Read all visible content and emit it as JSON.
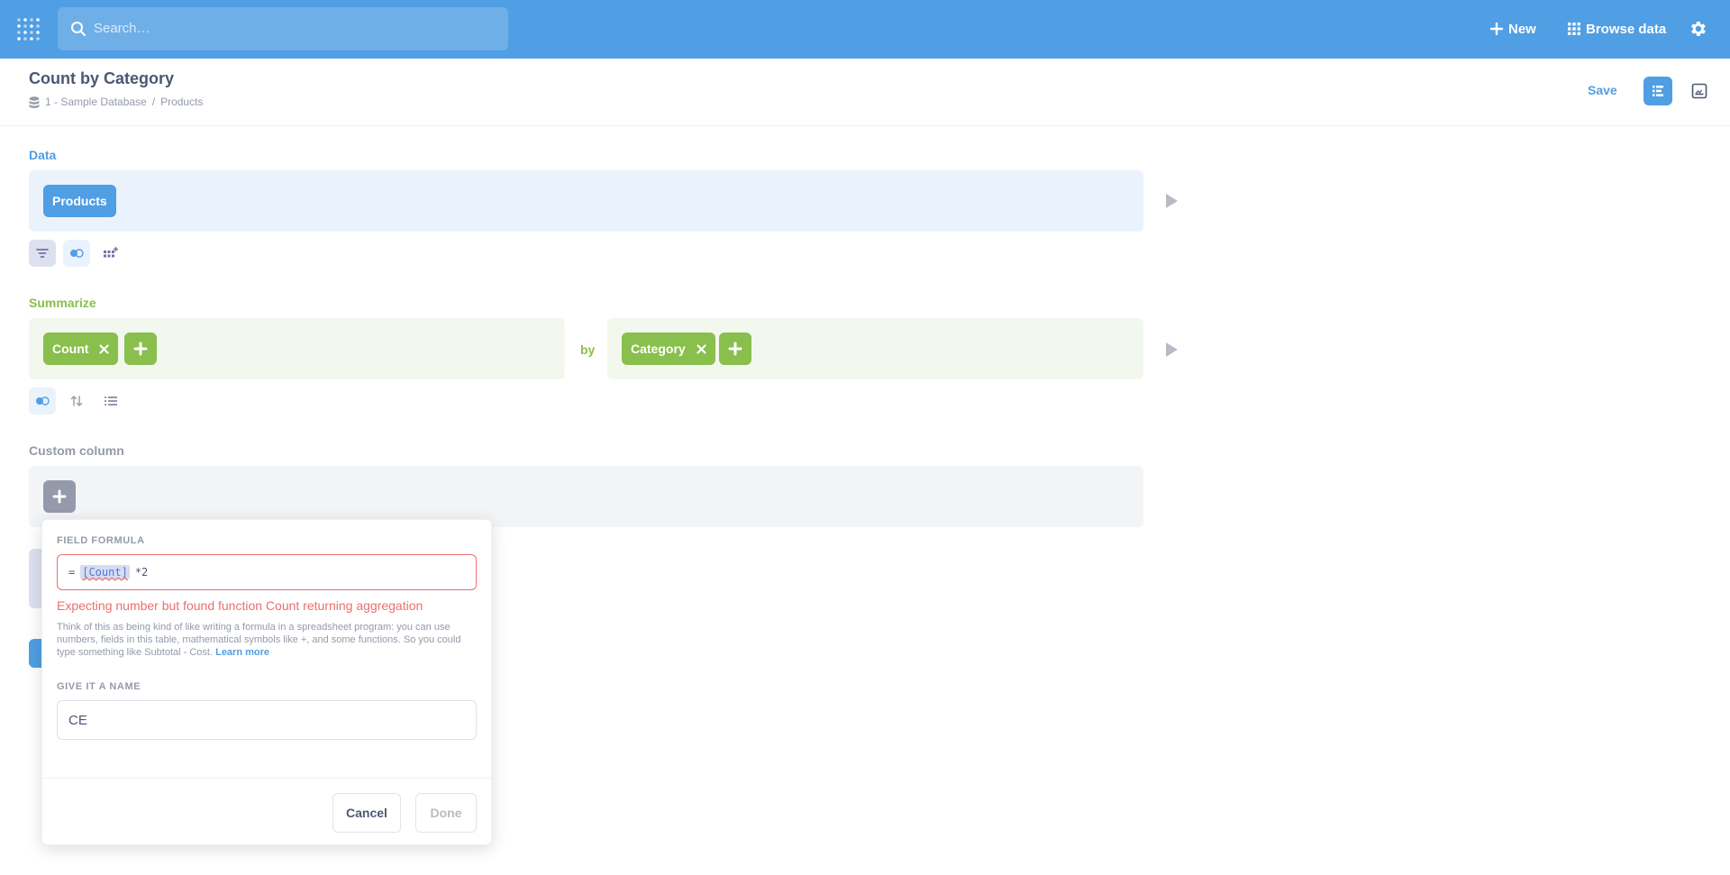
{
  "nav": {
    "search_placeholder": "Search…",
    "new_label": "New",
    "browse_label": "Browse data"
  },
  "header": {
    "title": "Count by Category",
    "breadcrumb": [
      "1 - Sample Database",
      "/",
      "Products"
    ],
    "save_label": "Save"
  },
  "data_section": {
    "label": "Data",
    "table_pill": "Products"
  },
  "summarize_section": {
    "label": "Summarize",
    "metric_pill": "Count",
    "by_label": "by",
    "breakout_pill": "Category"
  },
  "custom_column_section": {
    "label": "Custom column"
  },
  "popover": {
    "formula_label": "FIELD FORMULA",
    "formula_prefix": "=",
    "formula_token": "[Count]",
    "formula_rest": "*2",
    "error_text": "Expecting number but found function Count returning aggregation",
    "help_text": "Think of this as being kind of like writing a formula in a spreadsheet program: you can use numbers, fields in this table, mathematical symbols like +, and some functions. So you could type something like Subtotal - Cost.",
    "learn_more": "Learn more",
    "name_label": "GIVE IT A NAME",
    "name_value": "CE",
    "cancel_label": "Cancel",
    "done_label": "Done"
  },
  "colors": {
    "brand": "#509ee3",
    "summarize": "#88bf4d",
    "error": "#ed6e6e",
    "text_dark": "#4c5773",
    "text_light": "#949aab"
  }
}
